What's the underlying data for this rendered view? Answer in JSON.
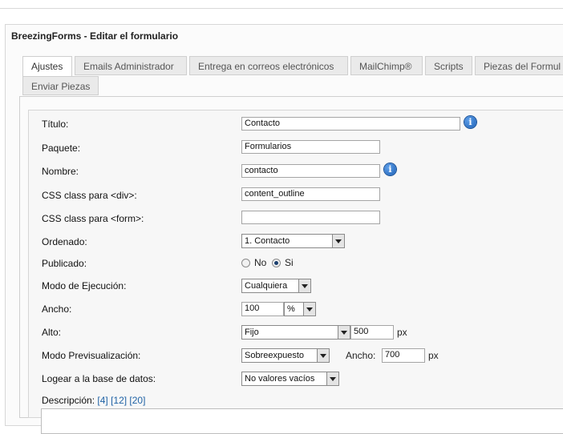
{
  "window": {
    "title": "BreezingForms - Editar el formulario"
  },
  "tabs": [
    {
      "label": "Ajustes",
      "active": true
    },
    {
      "label": "Emails Administrador",
      "active": false
    },
    {
      "label": "Entrega en correos electrónicos",
      "active": false
    },
    {
      "label": "MailChimp®",
      "active": false
    },
    {
      "label": "Scripts",
      "active": false
    },
    {
      "label": "Piezas del Formul",
      "active": false
    },
    {
      "label": "Enviar Piezas",
      "active": false
    }
  ],
  "form": {
    "titulo": {
      "label": "Título:",
      "value": "Contacto"
    },
    "paquete": {
      "label": "Paquete:",
      "value": "Formularios"
    },
    "nombre": {
      "label": "Nombre:",
      "value": "contacto"
    },
    "css_div": {
      "label": "CSS class para <div>:",
      "value": "content_outline"
    },
    "css_form": {
      "label": "CSS class para <form>:",
      "value": ""
    },
    "ordenado": {
      "label": "Ordenado:",
      "value": "1. Contacto"
    },
    "publicado": {
      "label": "Publicado:",
      "no_label": "No",
      "si_label": "Si",
      "selected": "Si"
    },
    "modo_ejecucion": {
      "label": "Modo de Ejecución:",
      "value": "Cualquiera"
    },
    "ancho": {
      "label": "Ancho:",
      "value": "100",
      "unit_value": "%"
    },
    "alto": {
      "label": "Alto:",
      "mode": "Fijo",
      "value": "500",
      "unit": "px"
    },
    "modo_previsualizacion": {
      "label": "Modo Previsualización:",
      "value": "Sobreexpuesto",
      "ancho_label": "Ancho:",
      "ancho_value": "700",
      "unit": "px"
    },
    "logear": {
      "label": "Logear a la base de datos:",
      "value": "No valores vacíos"
    },
    "descripcion": {
      "label": "Descripción:",
      "links": [
        "[4]",
        "[12]",
        "[20]"
      ]
    }
  },
  "icons": {
    "info": "info-icon",
    "dropdown": "chevron-down-icon"
  }
}
